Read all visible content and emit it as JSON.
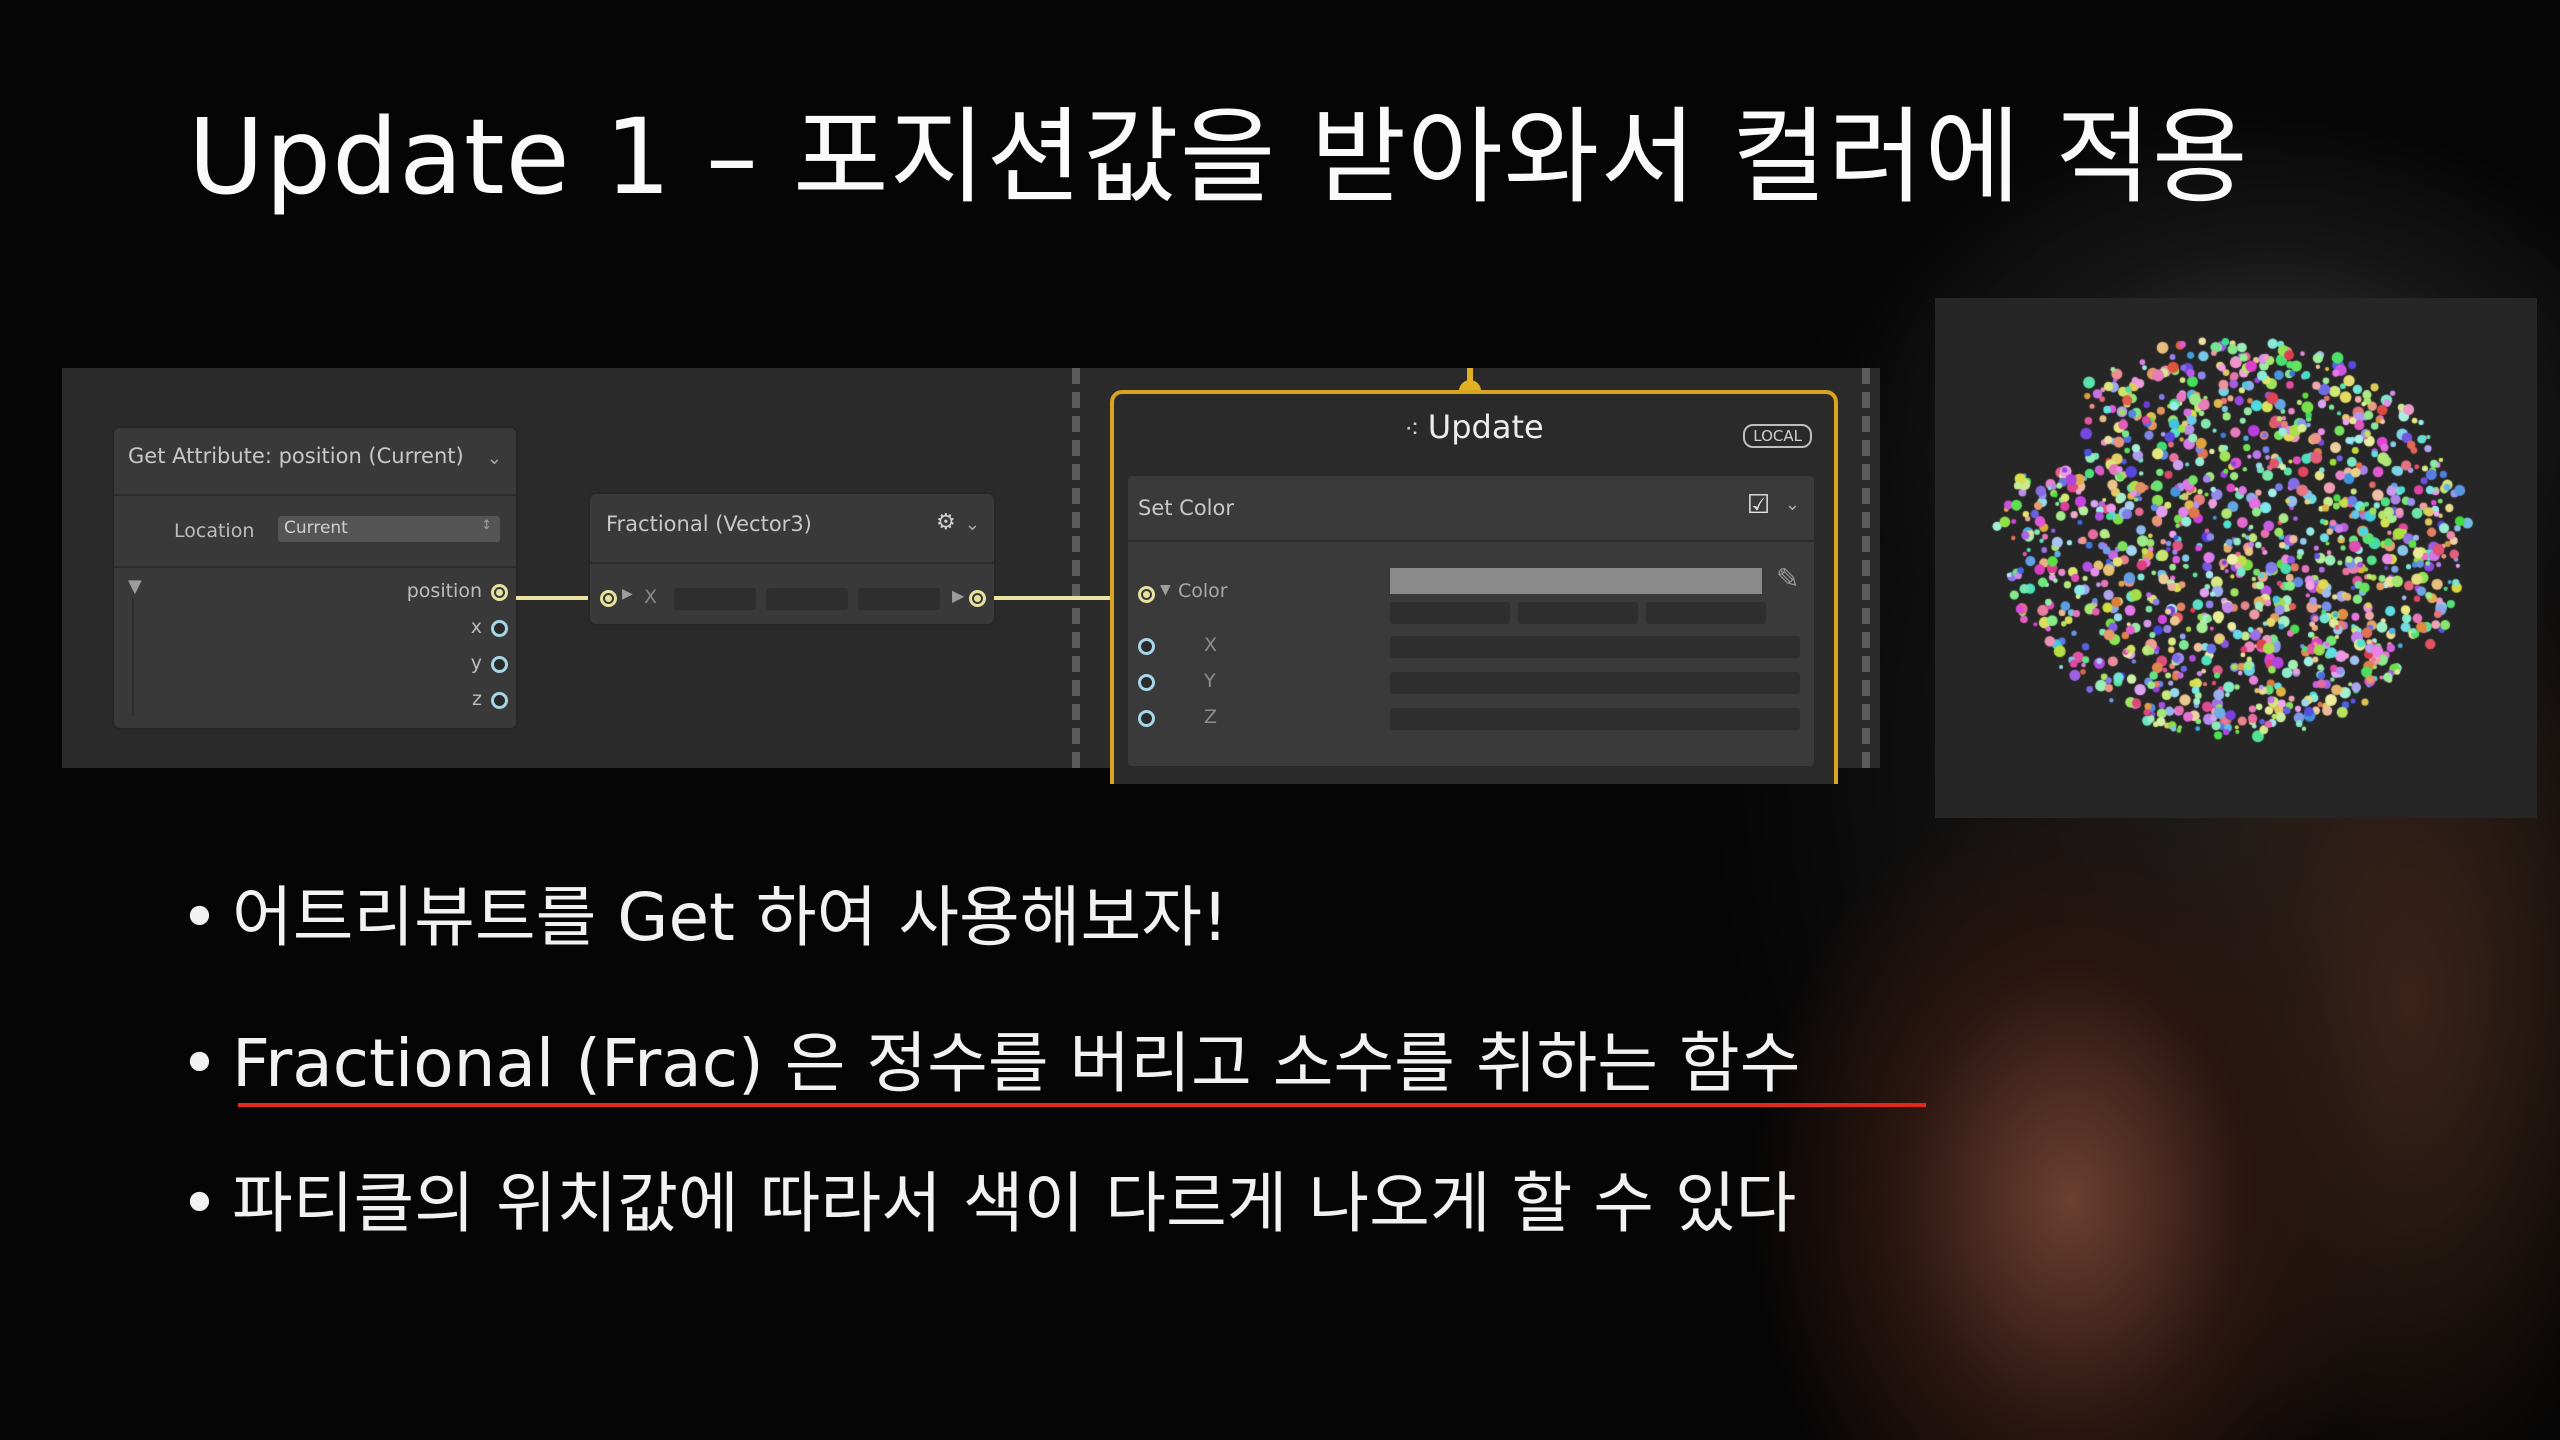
{
  "slide": {
    "title": "Update 1 – 포지션값을 받아와서 컬러에 적용"
  },
  "graph": {
    "get_attribute_node": {
      "title": "Get Attribute: position (Current)",
      "location_label": "Location",
      "location_value": "Current",
      "output_label": "position",
      "components": [
        "x",
        "y",
        "z"
      ]
    },
    "fractional_node": {
      "title": "Fractional (Vector3)",
      "input_label": "X"
    },
    "update_context": {
      "title": "Update",
      "tag": "LOCAL",
      "block_title": "Set Color",
      "color_label": "Color",
      "components": [
        "X",
        "Y",
        "Z"
      ]
    }
  },
  "bullets": [
    "어트리뷰트를 Get 하여 사용해보자!",
    "Fractional (Frac) 은 정수를 버리고 소수를 취하는 함수",
    "파티클의 위치값에 따라서 색이 다르게 나오게 할 수 있다"
  ],
  "colors": {
    "context_border": "#d8a520",
    "wire": "#e8e39e",
    "underline": "#e0281c"
  }
}
